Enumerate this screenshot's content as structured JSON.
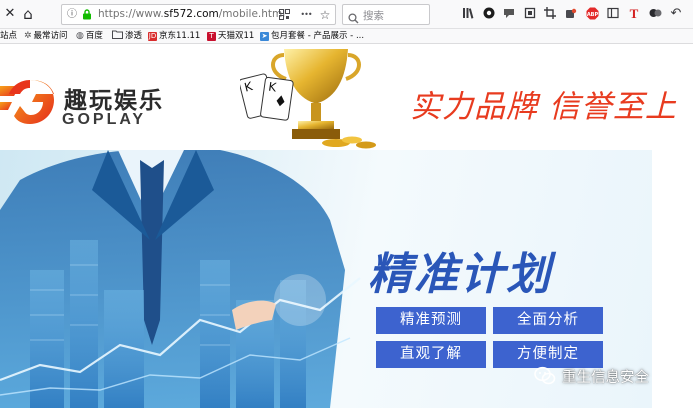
{
  "browser": {
    "url_scheme": "https://www.",
    "url_host": "sf572.com",
    "url_path": "/mobile.html",
    "search_placeholder": "搜索",
    "close_glyph": "✕",
    "home_glyph": "⌂",
    "more_glyph": "•••",
    "star_glyph": "☆",
    "info_glyph": "ⓘ",
    "menu_glyph": "↶"
  },
  "bookmarks": {
    "items": [
      {
        "label": "站点",
        "color": "#ffffff"
      },
      {
        "label": "最常访问",
        "color": "#6f6f73"
      },
      {
        "label": "百度",
        "color": "#4a4a4f"
      },
      {
        "label": "渗透",
        "color": "#8a8a8f"
      },
      {
        "label": "京东11.11",
        "color": "#d92c2c"
      },
      {
        "label": "天猫双11",
        "color": "#c8102e"
      },
      {
        "label": "包月套餐 - 产品展示 - ...",
        "color": "#3a88d8"
      }
    ]
  },
  "header": {
    "logo_cn": "趣玩娱乐",
    "logo_en": "GOPLAY",
    "slogan": "实力品牌 信誉至上"
  },
  "banner": {
    "headline": "精准计划",
    "tags": [
      "精准预测",
      "全面分析",
      "直观了解",
      "方便制定"
    ]
  },
  "watermark": {
    "text": "重生信息安全"
  },
  "colors": {
    "slogan_red": "#e83b1f",
    "banner_blue": "#3d63cf",
    "headline_blue": "#2a56b8",
    "logo_red": "#e8351c"
  }
}
